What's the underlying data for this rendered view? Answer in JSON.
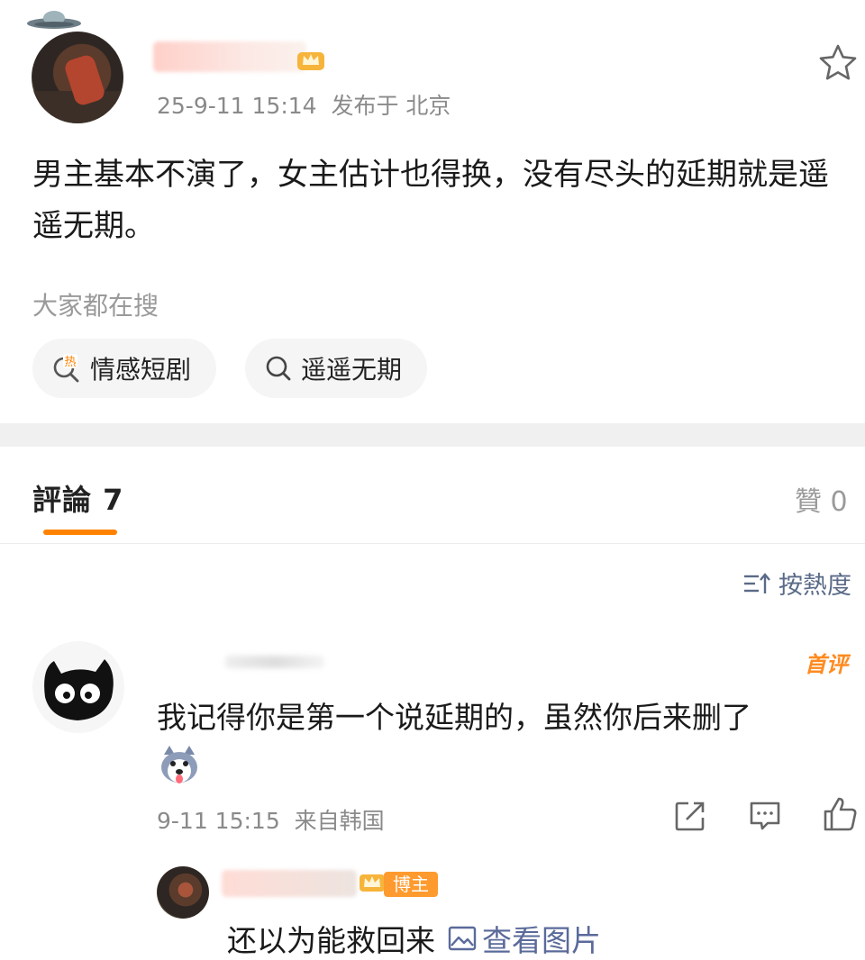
{
  "post": {
    "time": "25-9-11 15:14",
    "location": "发布于 北京",
    "text": "男主基本不演了，女主估计也得换，没有尽头的延期就是遥遥无期。"
  },
  "search": {
    "label": "大家都在搜",
    "chips": [
      {
        "label": "情感短剧",
        "icon": "hot-search-icon",
        "badge": "热"
      },
      {
        "label": "遥遥无期",
        "icon": "search-icon"
      }
    ]
  },
  "tabs": {
    "comments": "評論 7",
    "likes": "贊 0",
    "accent_color": "#ff8200"
  },
  "sort": {
    "label": "按熱度",
    "icon": "sort-icon"
  },
  "comment": {
    "badge": "首评",
    "text": "我记得你是第一个说延期的，虽然你后来删了",
    "time": "9-11 15:15",
    "source": "来自韩国",
    "actions": [
      "share-icon",
      "reply-icon",
      "like-icon"
    ]
  },
  "reply": {
    "author_badge": "博主",
    "text": "还以为能救回来",
    "view_image": "查看图片"
  }
}
